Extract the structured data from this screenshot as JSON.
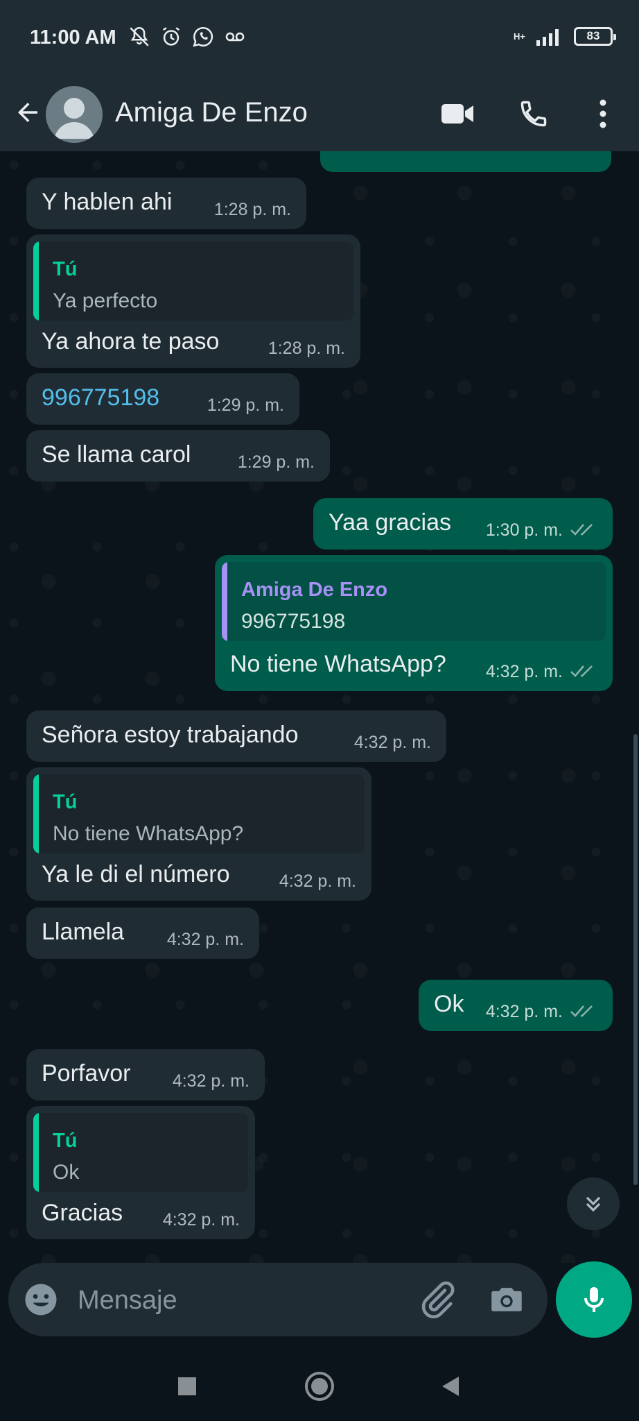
{
  "status_bar": {
    "time": "11:00 AM",
    "network": "H+",
    "battery": "83",
    "icons": [
      "muted-notifications-icon",
      "alarm-icon",
      "whatsapp-icon",
      "voicemail-icon",
      "signal-icon",
      "battery-icon"
    ]
  },
  "header": {
    "contact_name": "Amiga De Enzo",
    "actions": [
      "video-call-icon",
      "voice-call-icon",
      "more-options-icon"
    ]
  },
  "messages": [
    {
      "direction": "in",
      "text": "Y hablen ahi",
      "time": "1:28 p. m."
    },
    {
      "direction": "in",
      "reply_to": {
        "author": "Tú",
        "text": "Ya perfecto"
      },
      "text": "Ya ahora te paso",
      "time": "1:28 p. m."
    },
    {
      "direction": "in",
      "text": "996775198",
      "time": "1:29 p. m.",
      "is_link": true
    },
    {
      "direction": "in",
      "text": "Se llama carol",
      "time": "1:29 p. m."
    },
    {
      "direction": "out",
      "text": "Yaa gracias",
      "time": "1:30 p. m.",
      "status": "read"
    },
    {
      "direction": "out",
      "reply_to": {
        "author": "Amiga De Enzo",
        "text": "996775198"
      },
      "text": "No tiene WhatsApp?",
      "time": "4:32 p. m.",
      "status": "read"
    },
    {
      "direction": "in",
      "text": "Señora estoy trabajando",
      "time": "4:32 p. m."
    },
    {
      "direction": "in",
      "reply_to": {
        "author": "Tú",
        "text": "No tiene WhatsApp?"
      },
      "text": "Ya le di el número",
      "time": "4:32 p. m."
    },
    {
      "direction": "in",
      "text": "Llamela",
      "time": "4:32 p. m."
    },
    {
      "direction": "out",
      "text": "Ok",
      "time": "4:32 p. m.",
      "status": "read"
    },
    {
      "direction": "in",
      "text": "Porfavor",
      "time": "4:32 p. m."
    },
    {
      "direction": "in",
      "reply_to": {
        "author": "Tú",
        "text": "Ok"
      },
      "text": "Gracias",
      "time": "4:32 p. m."
    }
  ],
  "composer": {
    "placeholder": "Mensaje",
    "icons": [
      "emoji-icon",
      "attach-icon",
      "camera-icon",
      "mic-icon"
    ]
  },
  "colors": {
    "incoming_bubble": "#202c33",
    "outgoing_bubble": "#005c4b",
    "accent": "#00a884",
    "quote_self": "#06cf9c",
    "quote_contact": "#a791f7",
    "read_ticks": "#8bb3ab"
  }
}
